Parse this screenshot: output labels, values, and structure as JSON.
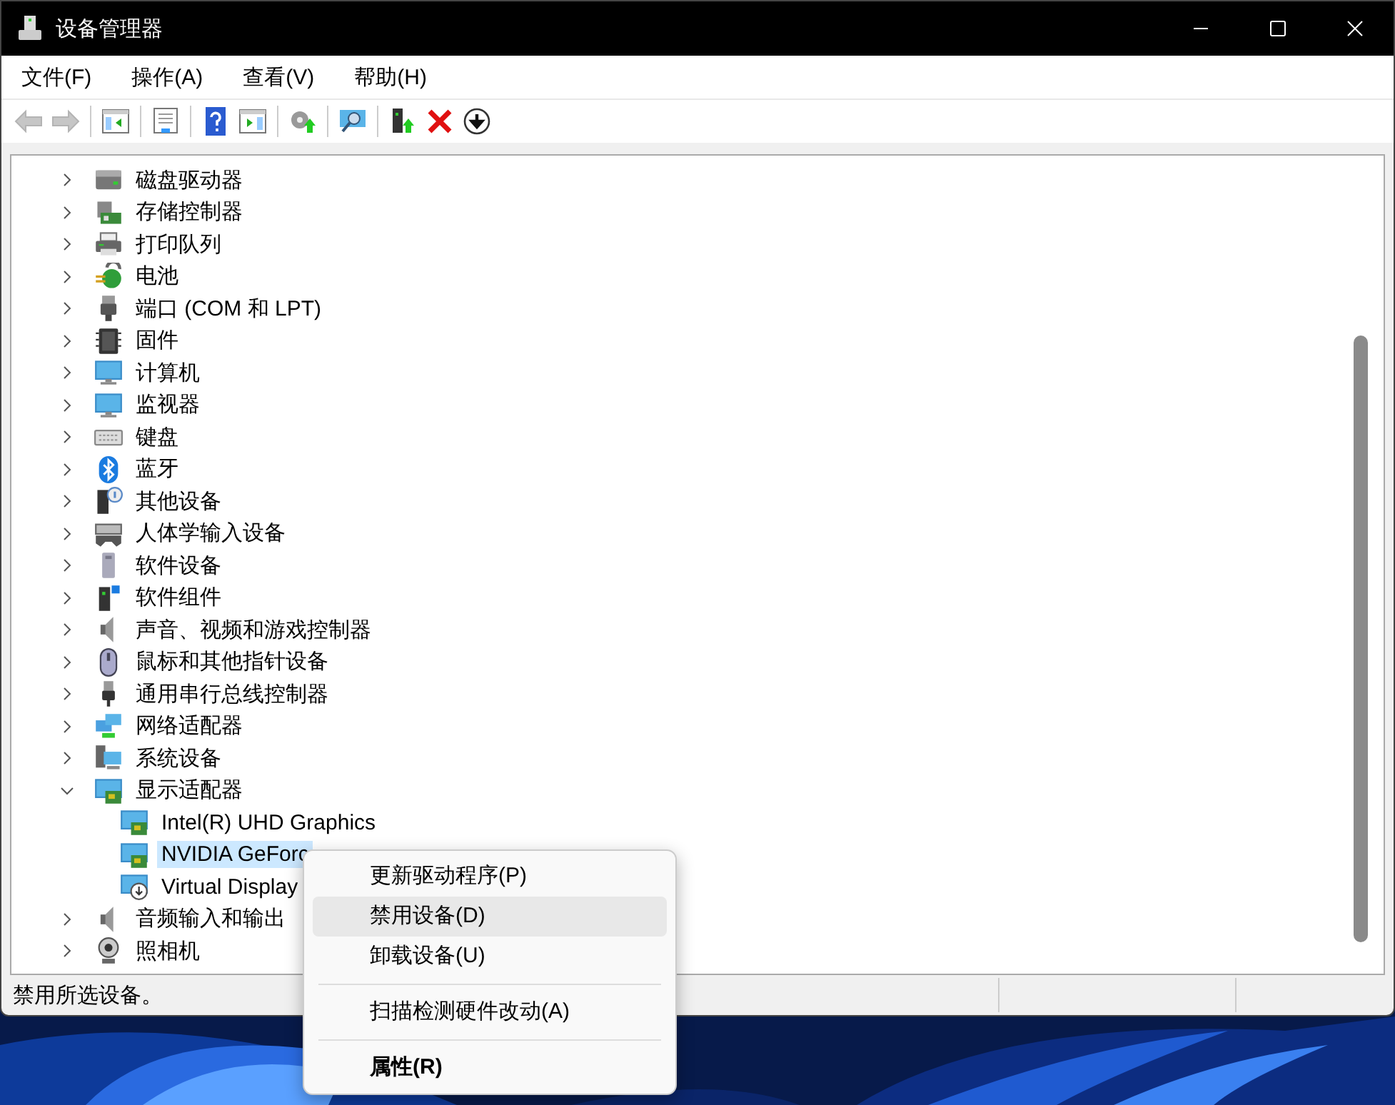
{
  "window": {
    "title": "设备管理器"
  },
  "menu_bar": [
    "文件(F)",
    "操作(A)",
    "查看(V)",
    "帮助(H)"
  ],
  "toolbar": [
    [
      {
        "kind": "back",
        "disabled": true
      },
      {
        "kind": "forward",
        "disabled": true
      }
    ],
    [
      {
        "kind": "tree-pane",
        "disabled": false
      }
    ],
    [
      {
        "kind": "properties",
        "disabled": false
      }
    ],
    [
      {
        "kind": "help",
        "disabled": false
      },
      {
        "kind": "action-pane",
        "disabled": false
      }
    ],
    [
      {
        "kind": "update",
        "disabled": false
      }
    ],
    [
      {
        "kind": "scan",
        "disabled": false
      }
    ],
    [
      {
        "kind": "enable",
        "disabled": false
      },
      {
        "kind": "uninstall",
        "disabled": false
      },
      {
        "kind": "disable",
        "disabled": false
      }
    ]
  ],
  "tree": [
    {
      "label": "磁盘驱动器",
      "kind": "disk",
      "expanded": false,
      "selected": false
    },
    {
      "label": "存储控制器",
      "kind": "storage",
      "expanded": false,
      "selected": false
    },
    {
      "label": "打印队列",
      "kind": "printer",
      "expanded": false,
      "selected": false
    },
    {
      "label": "电池",
      "kind": "battery",
      "expanded": false,
      "selected": false
    },
    {
      "label": "端口 (COM 和 LPT)",
      "kind": "port",
      "expanded": false,
      "selected": false
    },
    {
      "label": "固件",
      "kind": "chip",
      "expanded": false,
      "selected": false
    },
    {
      "label": "计算机",
      "kind": "monitor",
      "expanded": false,
      "selected": false
    },
    {
      "label": "监视器",
      "kind": "monitor",
      "expanded": false,
      "selected": false
    },
    {
      "label": "键盘",
      "kind": "keyboard",
      "expanded": false,
      "selected": false
    },
    {
      "label": "蓝牙",
      "kind": "bluetooth",
      "expanded": false,
      "selected": false
    },
    {
      "label": "其他设备",
      "kind": "unknown",
      "expanded": false,
      "selected": false
    },
    {
      "label": "人体学输入设备",
      "kind": "hid",
      "expanded": false,
      "selected": false
    },
    {
      "label": "软件设备",
      "kind": "tower",
      "expanded": false,
      "selected": false
    },
    {
      "label": "软件组件",
      "kind": "component",
      "expanded": false,
      "selected": false
    },
    {
      "label": "声音、视频和游戏控制器",
      "kind": "speaker",
      "expanded": false,
      "selected": false
    },
    {
      "label": "鼠标和其他指针设备",
      "kind": "mouse",
      "expanded": false,
      "selected": false
    },
    {
      "label": "通用串行总线控制器",
      "kind": "usb",
      "expanded": false,
      "selected": false
    },
    {
      "label": "网络适配器",
      "kind": "network",
      "expanded": false,
      "selected": false
    },
    {
      "label": "系统设备",
      "kind": "system",
      "expanded": false,
      "selected": false
    },
    {
      "label": "显示适配器",
      "kind": "display",
      "expanded": true,
      "selected": false,
      "children": [
        {
          "label": "Intel(R) UHD Graphics",
          "kind": "display",
          "selected": false
        },
        {
          "label": "NVIDIA GeForc",
          "kind": "display",
          "selected": true
        },
        {
          "label": "Virtual Display",
          "kind": "virtual",
          "selected": false
        }
      ]
    },
    {
      "label": "音频输入和输出",
      "kind": "speaker",
      "expanded": false,
      "selected": false
    },
    {
      "label": "照相机",
      "kind": "camera",
      "expanded": false,
      "selected": false
    }
  ],
  "context_menu": [
    [
      {
        "label": "更新驱动程序(P)",
        "highlighted": false,
        "default": false
      },
      {
        "label": "禁用设备(D)",
        "highlighted": true,
        "default": false
      },
      {
        "label": "卸载设备(U)",
        "highlighted": false,
        "default": false
      }
    ],
    [
      {
        "label": "扫描检测硬件改动(A)",
        "highlighted": false,
        "default": false
      }
    ],
    [
      {
        "label": "属性(R)",
        "highlighted": false,
        "default": true
      }
    ]
  ],
  "status_bar": {
    "text": "禁用所选设备。"
  }
}
